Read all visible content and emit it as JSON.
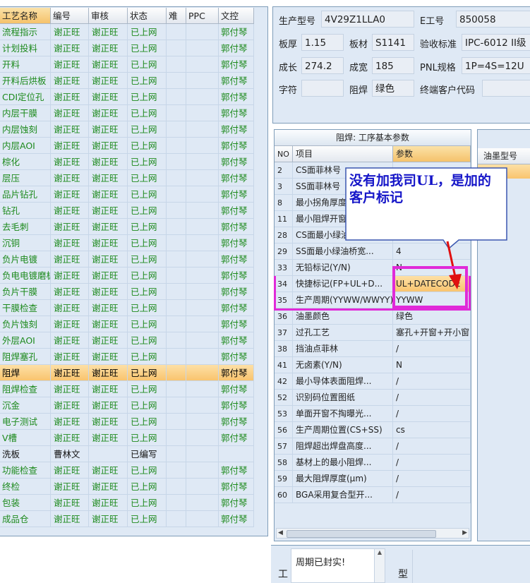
{
  "left_grid": {
    "headers": [
      "工艺名称",
      "编号",
      "审核",
      "状态",
      "难",
      "PPC",
      "文控"
    ],
    "rows": [
      [
        "流程指示",
        "谢正旺",
        "谢正旺",
        "已上网",
        "",
        "",
        "郭付琴"
      ],
      [
        "计划投料",
        "谢正旺",
        "谢正旺",
        "已上网",
        "",
        "",
        "郭付琴"
      ],
      [
        "开料",
        "谢正旺",
        "谢正旺",
        "已上网",
        "",
        "",
        "郭付琴"
      ],
      [
        "开料后烘板",
        "谢正旺",
        "谢正旺",
        "已上网",
        "",
        "",
        "郭付琴"
      ],
      [
        "CDI定位孔",
        "谢正旺",
        "谢正旺",
        "已上网",
        "",
        "",
        "郭付琴"
      ],
      [
        "内层干膜",
        "谢正旺",
        "谢正旺",
        "已上网",
        "",
        "",
        "郭付琴"
      ],
      [
        "内层蚀刻",
        "谢正旺",
        "谢正旺",
        "已上网",
        "",
        "",
        "郭付琴"
      ],
      [
        "内层AOI",
        "谢正旺",
        "谢正旺",
        "已上网",
        "",
        "",
        "郭付琴"
      ],
      [
        "棕化",
        "谢正旺",
        "谢正旺",
        "已上网",
        "",
        "",
        "郭付琴"
      ],
      [
        "层压",
        "谢正旺",
        "谢正旺",
        "已上网",
        "",
        "",
        "郭付琴"
      ],
      [
        "品片钻孔",
        "谢正旺",
        "谢正旺",
        "已上网",
        "",
        "",
        "郭付琴"
      ],
      [
        "钻孔",
        "谢正旺",
        "谢正旺",
        "已上网",
        "",
        "",
        "郭付琴"
      ],
      [
        "去毛刺",
        "谢正旺",
        "谢正旺",
        "已上网",
        "",
        "",
        "郭付琴"
      ],
      [
        "沉铜",
        "谢正旺",
        "谢正旺",
        "已上网",
        "",
        "",
        "郭付琴"
      ],
      [
        "负片电镀",
        "谢正旺",
        "谢正旺",
        "已上网",
        "",
        "",
        "郭付琴"
      ],
      [
        "负电电镀磨板",
        "谢正旺",
        "谢正旺",
        "已上网",
        "",
        "",
        "郭付琴"
      ],
      [
        "负片干膜",
        "谢正旺",
        "谢正旺",
        "已上网",
        "",
        "",
        "郭付琴"
      ],
      [
        "干膜检查",
        "谢正旺",
        "谢正旺",
        "已上网",
        "",
        "",
        "郭付琴"
      ],
      [
        "负片蚀刻",
        "谢正旺",
        "谢正旺",
        "已上网",
        "",
        "",
        "郭付琴"
      ],
      [
        "外层AOI",
        "谢正旺",
        "谢正旺",
        "已上网",
        "",
        "",
        "郭付琴"
      ],
      [
        "阻焊塞孔",
        "谢正旺",
        "谢正旺",
        "已上网",
        "",
        "",
        "郭付琴"
      ],
      [
        "阻焊",
        "谢正旺",
        "谢正旺",
        "已上网",
        "",
        "",
        "郭付琴"
      ],
      [
        "阻焊检查",
        "谢正旺",
        "谢正旺",
        "已上网",
        "",
        "",
        "郭付琴"
      ],
      [
        "沉金",
        "谢正旺",
        "谢正旺",
        "已上网",
        "",
        "",
        "郭付琴"
      ],
      [
        "电子测试",
        "谢正旺",
        "谢正旺",
        "已上网",
        "",
        "",
        "郭付琴"
      ],
      [
        "V槽",
        "谢正旺",
        "谢正旺",
        "已上网",
        "",
        "",
        "郭付琴"
      ],
      [
        "洗板",
        "曹林文",
        "",
        "已编写",
        "",
        "",
        ""
      ],
      [
        "功能检查",
        "谢正旺",
        "谢正旺",
        "已上网",
        "",
        "",
        "郭付琴"
      ],
      [
        "终检",
        "谢正旺",
        "谢正旺",
        "已上网",
        "",
        "",
        "郭付琴"
      ],
      [
        "包装",
        "谢正旺",
        "谢正旺",
        "已上网",
        "",
        "",
        "郭付琴"
      ],
      [
        "成品仓",
        "谢正旺",
        "谢正旺",
        "已上网",
        "",
        "",
        "郭付琴"
      ]
    ]
  },
  "top_fields": {
    "model_label": "生产型号",
    "model_value": "4V29Z1LLA0",
    "eno_label": "E工号",
    "eno_value": "850058",
    "thick_label": "板厚",
    "thick_value": "1.15",
    "mat_label": "板材",
    "mat_value": "S1141",
    "std_label": "验收标准",
    "std_value": "IPC-6012 II级",
    "len_label": "成长",
    "len_value": "274.2",
    "wid_label": "成宽",
    "wid_value": "185",
    "pnl_label": "PNL规格",
    "pnl_value": "1P=4S=12U",
    "char_label": "字符",
    "char_value": "",
    "mask_label": "阻焊",
    "mask_value": "绿色",
    "cust_label": "终端客户代码",
    "cust_value": ""
  },
  "mid_grid": {
    "title": "阻焊: 工序基本参数",
    "headers": [
      "NO",
      "项目",
      "参数"
    ],
    "rows": [
      [
        "2",
        "CS面菲林号",
        ""
      ],
      [
        "3",
        "SS面菲林号",
        ""
      ],
      [
        "8",
        "最小拐角厚度",
        ""
      ],
      [
        "11",
        "最小阻焊开窗",
        ""
      ],
      [
        "28",
        "CS面最小绿油",
        ""
      ],
      [
        "29",
        "SS面最小绿油桥宽...",
        "4"
      ],
      [
        "33",
        "无铅标记(Y/N)",
        "N"
      ],
      [
        "34",
        "快捷标记(FP+UL+D...",
        "UL+DATECODE"
      ],
      [
        "35",
        "生产周期(YYWW/WWYY)",
        "YYWW"
      ],
      [
        "36",
        "油墨颜色",
        "绿色"
      ],
      [
        "37",
        "过孔工艺",
        "塞孔+开窗+开小窗"
      ],
      [
        "38",
        "挡油点菲林",
        "/"
      ],
      [
        "41",
        "无卤素(Y/N)",
        "N"
      ],
      [
        "42",
        "最小导体表面阻焊...",
        "/"
      ],
      [
        "52",
        "识别码位置图纸",
        "/"
      ],
      [
        "53",
        "单面开窗不掏曝光...",
        "/"
      ],
      [
        "56",
        "生产周期位置(CS+SS)",
        "cs"
      ],
      [
        "57",
        "阻焊超出焊盘高度...",
        "/"
      ],
      [
        "58",
        "基材上的最小阻焊...",
        "/"
      ],
      [
        "59",
        "最大阻焊厚度(μm)",
        "/"
      ],
      [
        "60",
        "BGA采用复合型开...",
        "/"
      ]
    ]
  },
  "side_panel": {
    "header": "油墨型号"
  },
  "bottom": {
    "label_left": "工",
    "memo_text": "周期已封实!",
    "label_right": "型"
  },
  "annotation": {
    "text": "没有加我司UL，是加的客户标记"
  },
  "colors": {
    "green_text": "#1d8a1d",
    "selected_row": "#f9c46e",
    "panel_bg": "#dfe9f5",
    "annotation_blue": "#1515c8",
    "highlight_magenta": "#e02ad8",
    "arrow_red": "#e01010"
  }
}
